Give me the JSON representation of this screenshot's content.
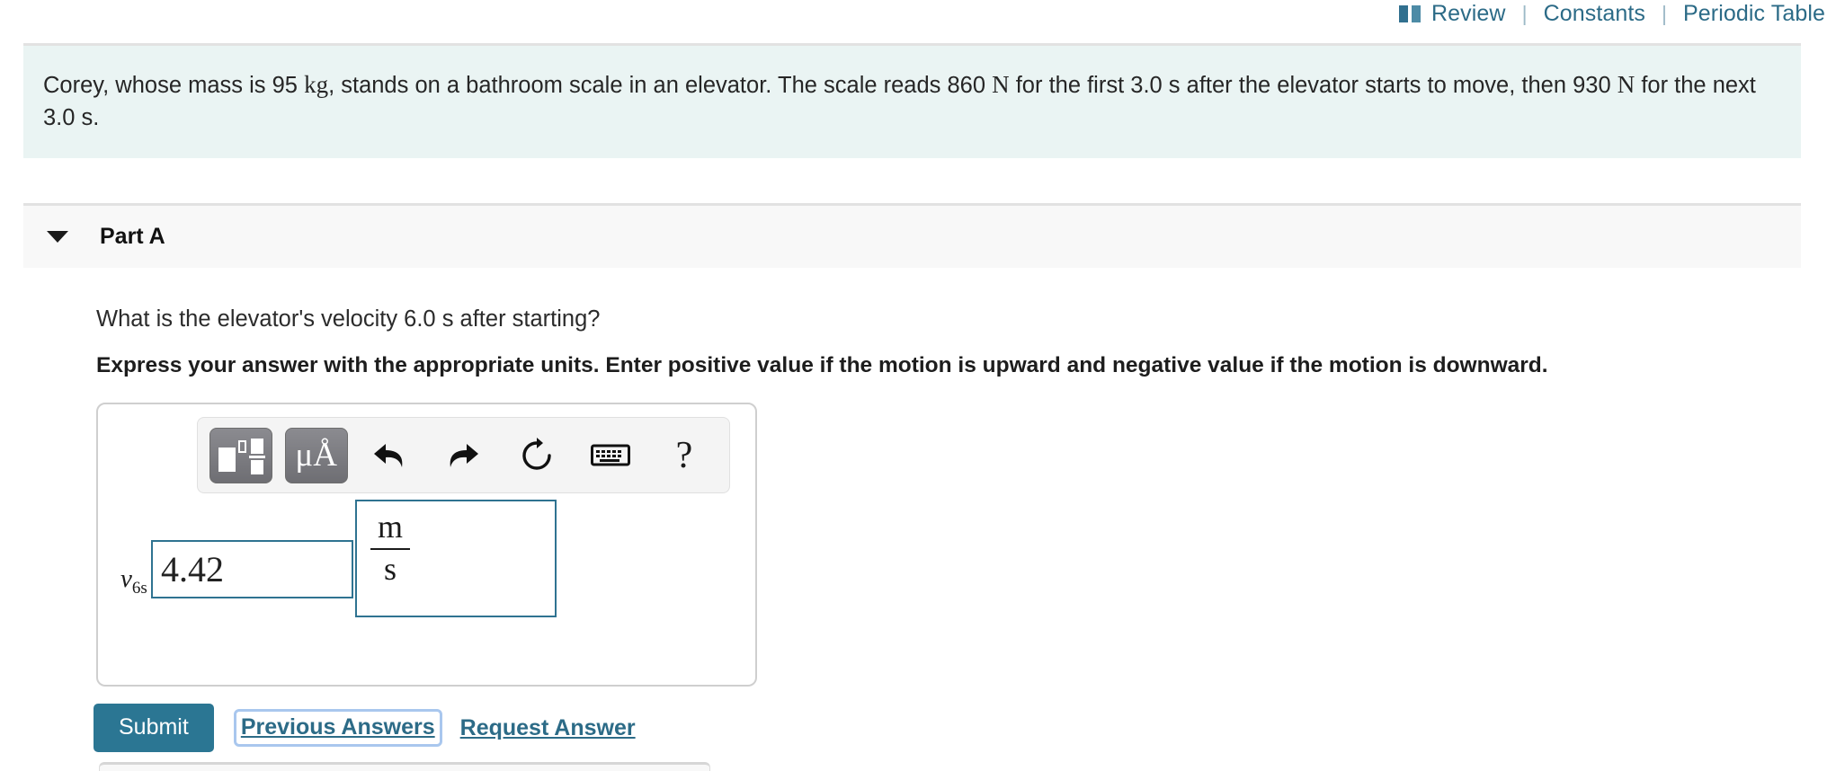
{
  "topbar": {
    "review": {
      "label": "Review",
      "icon": "book-icon"
    },
    "separator": "|",
    "constants": "Constants",
    "periodic_table": "Periodic Table",
    "link_color": "#2c6b87"
  },
  "problem": {
    "text_part1": "Corey, whose mass is 95 ",
    "unit_kg": "kg",
    "text_part2": ", stands on a bathroom scale in an elevator. The scale reads 860 ",
    "unit_N1": "N",
    "text_part3": " for the first 3.0 s after the elevator starts to move, then 930 ",
    "unit_N2": "N",
    "text_part4": " for the next 3.0 s.",
    "background": "#eaf4f3"
  },
  "part": {
    "title": "Part A",
    "caret_icon": "caret-down-icon",
    "question": "What is the elevator's velocity 6.0 s after starting?",
    "instructions": "Express your answer with the appropriate units. Enter positive value if the motion is upward and negative value if the motion is downward."
  },
  "toolbar": {
    "buttons": [
      {
        "name": "math-template-button",
        "icon": "math-template-icon",
        "label": ""
      },
      {
        "name": "units-button",
        "icon": "mu-angstrom-icon",
        "label": "μÅ"
      },
      {
        "name": "undo-button",
        "icon": "undo-arrow-icon",
        "label": ""
      },
      {
        "name": "redo-button",
        "icon": "redo-arrow-icon",
        "label": ""
      },
      {
        "name": "reset-button",
        "icon": "refresh-circle-icon",
        "label": ""
      },
      {
        "name": "keyboard-button",
        "icon": "keyboard-icon",
        "label": ""
      },
      {
        "name": "help-button",
        "icon": "question-mark-icon",
        "label": "?"
      }
    ]
  },
  "answer": {
    "variable": "v",
    "subscript": "6s",
    "equals": "=",
    "value": "4.42",
    "value_placeholder": "",
    "unit_numerator": "m",
    "unit_denominator": "s",
    "field_border_color": "#2f7391"
  },
  "actions": {
    "submit": "Submit",
    "previous_answers": "Previous Answers",
    "request_answer": "Request Answer",
    "submit_color": "#2b7693",
    "focus_ring_color": "#a9c7ee"
  }
}
